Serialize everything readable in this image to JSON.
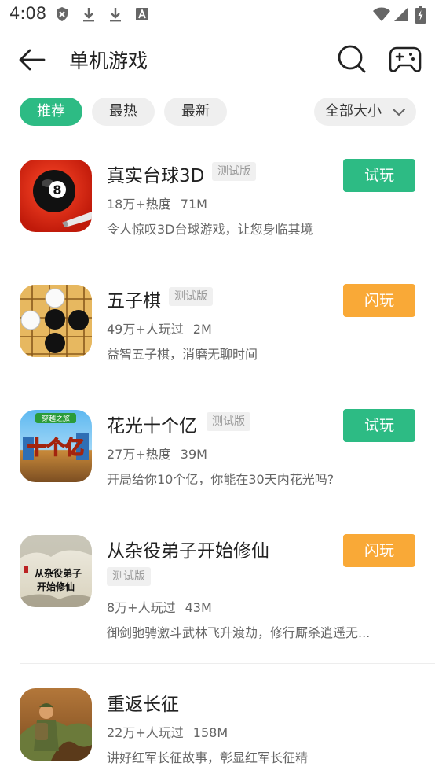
{
  "status_bar": {
    "time": "4:08",
    "left_icons": [
      "shield-icon",
      "download-icon",
      "download-icon",
      "a-notification-icon"
    ],
    "right_icons": [
      "wifi-icon",
      "signal-icon",
      "battery-charging-icon"
    ]
  },
  "header": {
    "title": "单机游戏",
    "back_icon": "arrow-left-icon",
    "search_icon": "search-icon",
    "gamepad_icon": "gamepad-icon"
  },
  "filters": {
    "chips": [
      {
        "label": "推荐",
        "active": true
      },
      {
        "label": "最热",
        "active": false
      },
      {
        "label": "最新",
        "active": false
      }
    ],
    "size_select": "全部大小"
  },
  "games": [
    {
      "name": "真实台球3D",
      "tag": "测试版",
      "stat": "18万+热度",
      "size": "71M",
      "desc": "令人惊叹3D台球游戏，让您身临其境",
      "button": "试玩"
    },
    {
      "name": "五子棋",
      "tag": "测试版",
      "stat": "49万+人玩过",
      "size": "2M",
      "desc": "益智五子棋，消磨无聊时间",
      "button": "闪玩"
    },
    {
      "name": "花光十个亿",
      "tag": "测试版",
      "stat": "27万+热度",
      "size": "39M",
      "desc": "开局给你10个亿，你能在30天内花光吗?",
      "button": "试玩",
      "icon_text": "十个亿",
      "icon_badge": "穿越之旅"
    },
    {
      "name": "从杂役弟子开始修仙",
      "tag": "测试版",
      "stat": "8万+人玩过",
      "size": "43M",
      "desc": "御剑驰骋激斗武林飞升渡劫，修行厮杀逍遥无...",
      "button": "闪玩",
      "icon_text_1": "从杂役弟子",
      "icon_text_2": "开始修仙"
    },
    {
      "name": "重返长征",
      "stat": "22万+人玩过",
      "size": "158M",
      "desc": "讲好红军长征故事，彰显红军长征精"
    }
  ],
  "colors": {
    "accent_green": "#2dbb84",
    "accent_orange": "#f9a937"
  }
}
